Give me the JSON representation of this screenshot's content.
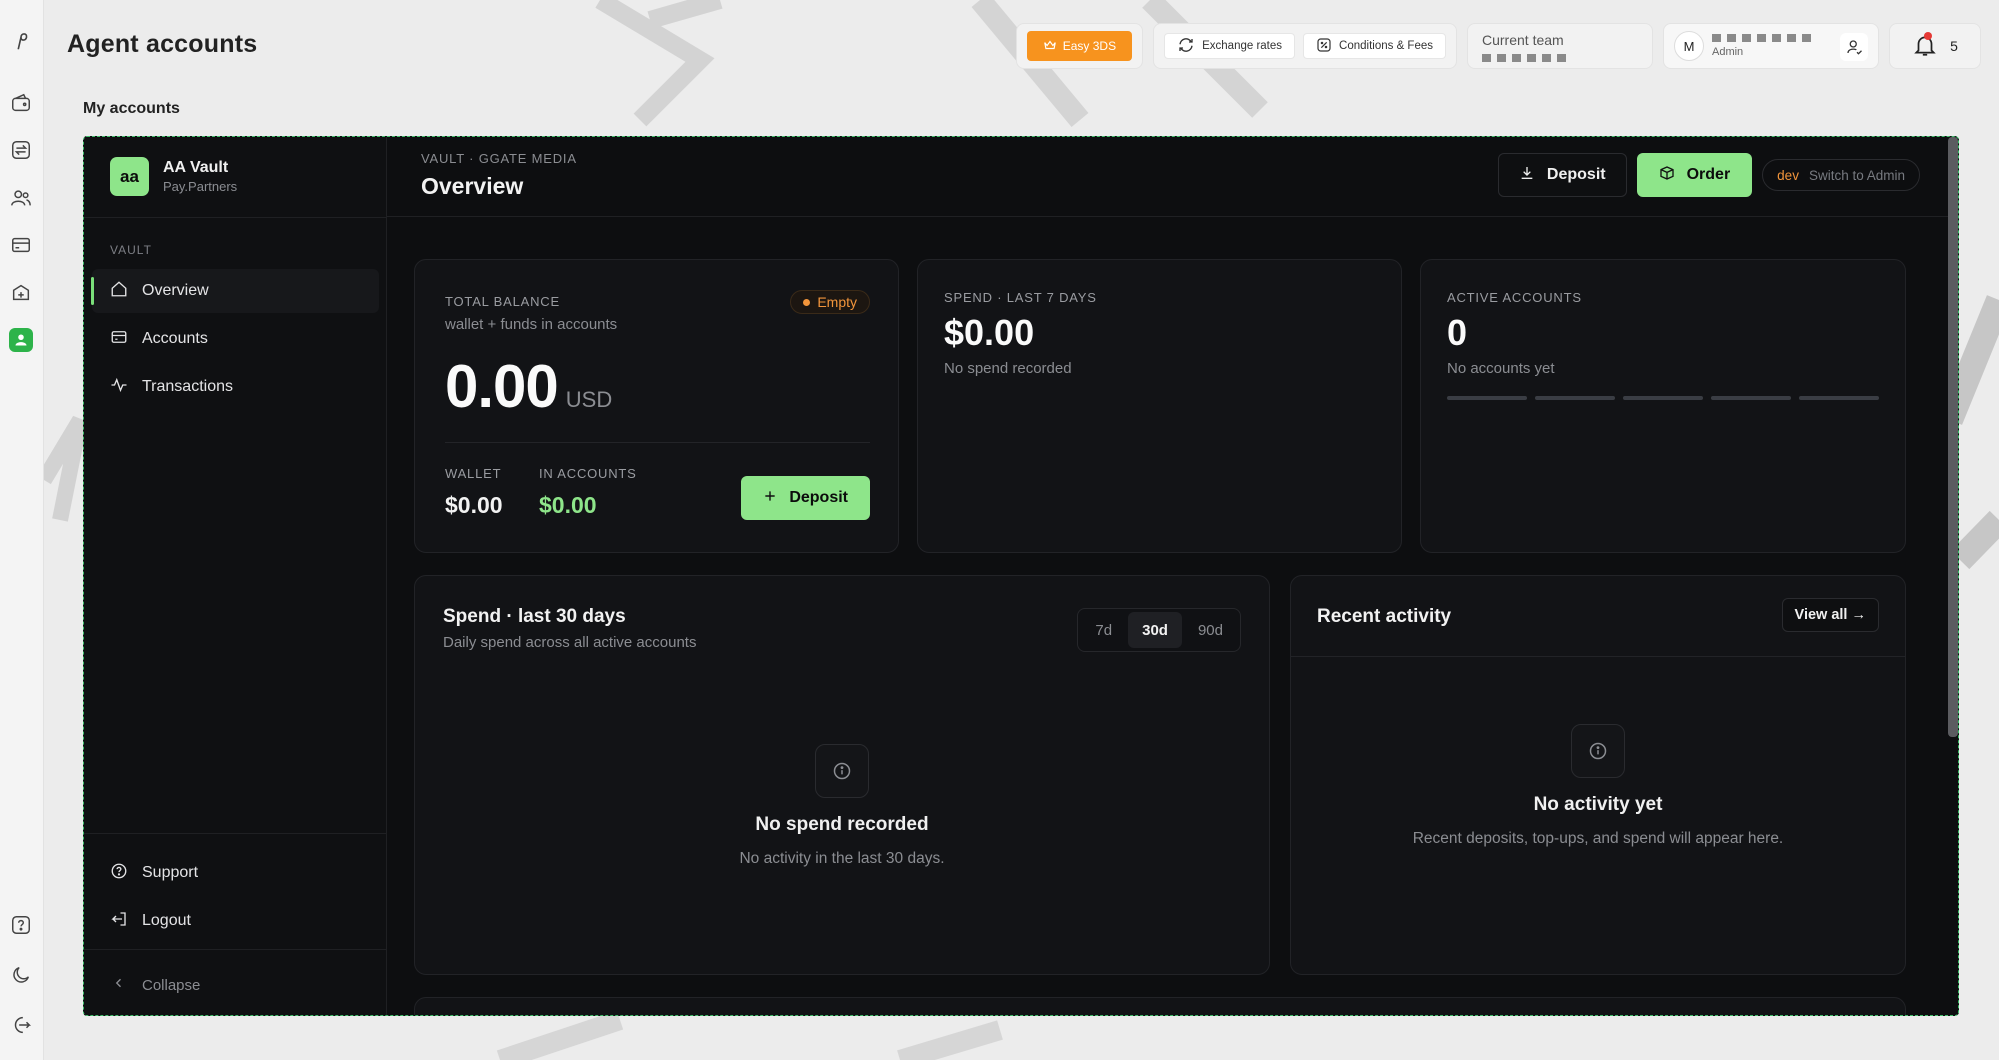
{
  "app": {
    "page_title": "Agent accounts",
    "section_label": "My accounts"
  },
  "topbar": {
    "easy3ds_label": "Easy 3DS",
    "exchange_rates_label": "Exchange rates",
    "conditions_label": "Conditions & Fees",
    "team_label": "Current team",
    "user_initial": "M",
    "user_role": "Admin",
    "notifications_count": "5"
  },
  "rail": {
    "icons": [
      "logo-icon",
      "wallet-icon",
      "transfer-icon",
      "users-icon",
      "card-icon",
      "add-box-icon",
      "vault-icon",
      "help-icon",
      "moon-icon",
      "logout-icon"
    ]
  },
  "vault": {
    "brand_initials": "aa",
    "brand_name": "AA Vault",
    "brand_sub": "Pay.Partners",
    "section": "VAULT",
    "nav": [
      {
        "label": "Overview",
        "icon": "home-icon",
        "active": true
      },
      {
        "label": "Accounts",
        "icon": "card-icon",
        "active": false
      },
      {
        "label": "Transactions",
        "icon": "activity-icon",
        "active": false
      }
    ],
    "support_label": "Support",
    "logout_label": "Logout",
    "collapse_label": "Collapse"
  },
  "header": {
    "breadcrumb": "VAULT · GGATE MEDIA",
    "title": "Overview",
    "deposit_label": "Deposit",
    "order_label": "Order",
    "dev_tag": "dev",
    "switch_label": "Switch to Admin"
  },
  "balance": {
    "label": "TOTAL BALANCE",
    "sub": "wallet + funds in accounts",
    "badge": "Empty",
    "amount": "0.00",
    "currency": "USD",
    "wallet_label": "WALLET",
    "wallet_value": "$0.00",
    "in_accounts_label": "IN ACCOUNTS",
    "in_accounts_value": "$0.00",
    "deposit_label": "Deposit"
  },
  "spend7": {
    "label": "SPEND · LAST 7 DAYS",
    "value": "$0.00",
    "sub": "No spend recorded"
  },
  "active_accounts": {
    "label": "ACTIVE ACCOUNTS",
    "value": "0",
    "sub": "No accounts yet"
  },
  "spend30": {
    "title": "Spend · last 30 days",
    "sub": "Daily spend across all active accounts",
    "ranges": [
      "7d",
      "30d",
      "90d"
    ],
    "active_range": "30d",
    "empty_title": "No spend recorded",
    "empty_sub": "No activity in the last 30 days."
  },
  "activity": {
    "title": "Recent activity",
    "view_all": "View all →",
    "empty_title": "No activity yet",
    "empty_sub": "Recent deposits, top-ups, and spend will appear here."
  },
  "colors": {
    "accent_green": "#8ee58a",
    "accent_orange": "#f7931e",
    "dark_bg": "#0d0e10",
    "frame_border": "#3fbf6a"
  }
}
